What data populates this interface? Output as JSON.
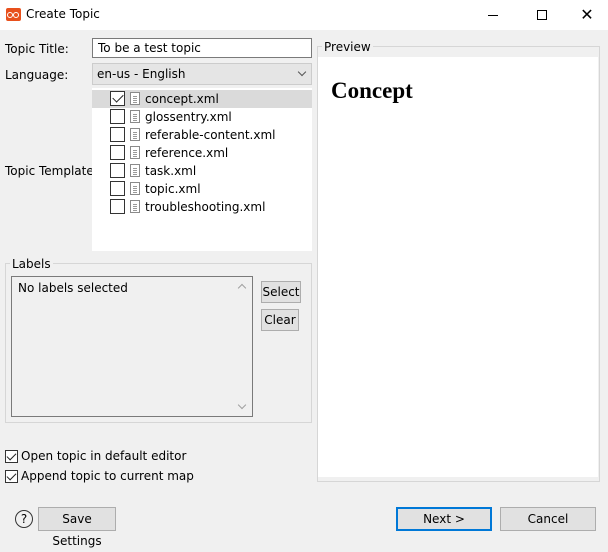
{
  "window": {
    "title": "Create Topic",
    "controls": {
      "minimize": "—",
      "maximize": "☐",
      "close": "✕"
    }
  },
  "form": {
    "topic_title_label": "Topic Title:",
    "topic_title_value": "To be a test topic",
    "language_label": "Language:",
    "language_value": "en-us - English",
    "template_label": "Topic Template:"
  },
  "templates": [
    {
      "name": "concept.xml",
      "checked": true,
      "selected": true
    },
    {
      "name": "glossentry.xml",
      "checked": false,
      "selected": false
    },
    {
      "name": "referable-content.xml",
      "checked": false,
      "selected": false
    },
    {
      "name": "reference.xml",
      "checked": false,
      "selected": false
    },
    {
      "name": "task.xml",
      "checked": false,
      "selected": false
    },
    {
      "name": "topic.xml",
      "checked": false,
      "selected": false
    },
    {
      "name": "troubleshooting.xml",
      "checked": false,
      "selected": false
    }
  ],
  "labels_group": {
    "title": "Labels",
    "empty_text": "No labels selected",
    "select_button": "Select",
    "clear_button": "Clear"
  },
  "preview": {
    "title": "Preview",
    "heading": "Concept"
  },
  "options": {
    "open_in_editor": {
      "label": "Open topic in default editor",
      "checked": true
    },
    "append_to_map": {
      "label": "Append topic to current map",
      "checked": true
    }
  },
  "footer": {
    "help": "?",
    "save_settings": "Save Settings",
    "next": "Next >",
    "cancel": "Cancel"
  },
  "colors": {
    "accent": "#0078d7",
    "app_icon": "#e8501c",
    "background": "#f0f0f0"
  }
}
